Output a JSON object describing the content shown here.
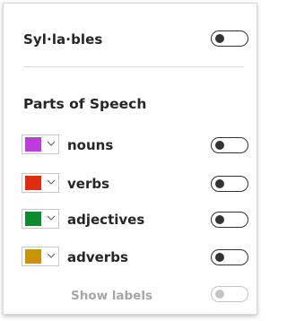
{
  "syllables": {
    "label": "Syl·la·bles",
    "toggle_on": false
  },
  "parts_of_speech": {
    "title": "Parts of Speech",
    "items": [
      {
        "label": "nouns",
        "color": "#b93fd8",
        "toggle_on": false
      },
      {
        "label": "verbs",
        "color": "#e02c10",
        "toggle_on": false
      },
      {
        "label": "adjectives",
        "color": "#0e8a2e",
        "toggle_on": false
      },
      {
        "label": "adverbs",
        "color": "#c8950a",
        "toggle_on": false
      }
    ],
    "show_labels": {
      "label": "Show labels",
      "toggle_on": false,
      "disabled": true
    }
  },
  "icons": {
    "dropdown": "chevron-down-icon"
  }
}
